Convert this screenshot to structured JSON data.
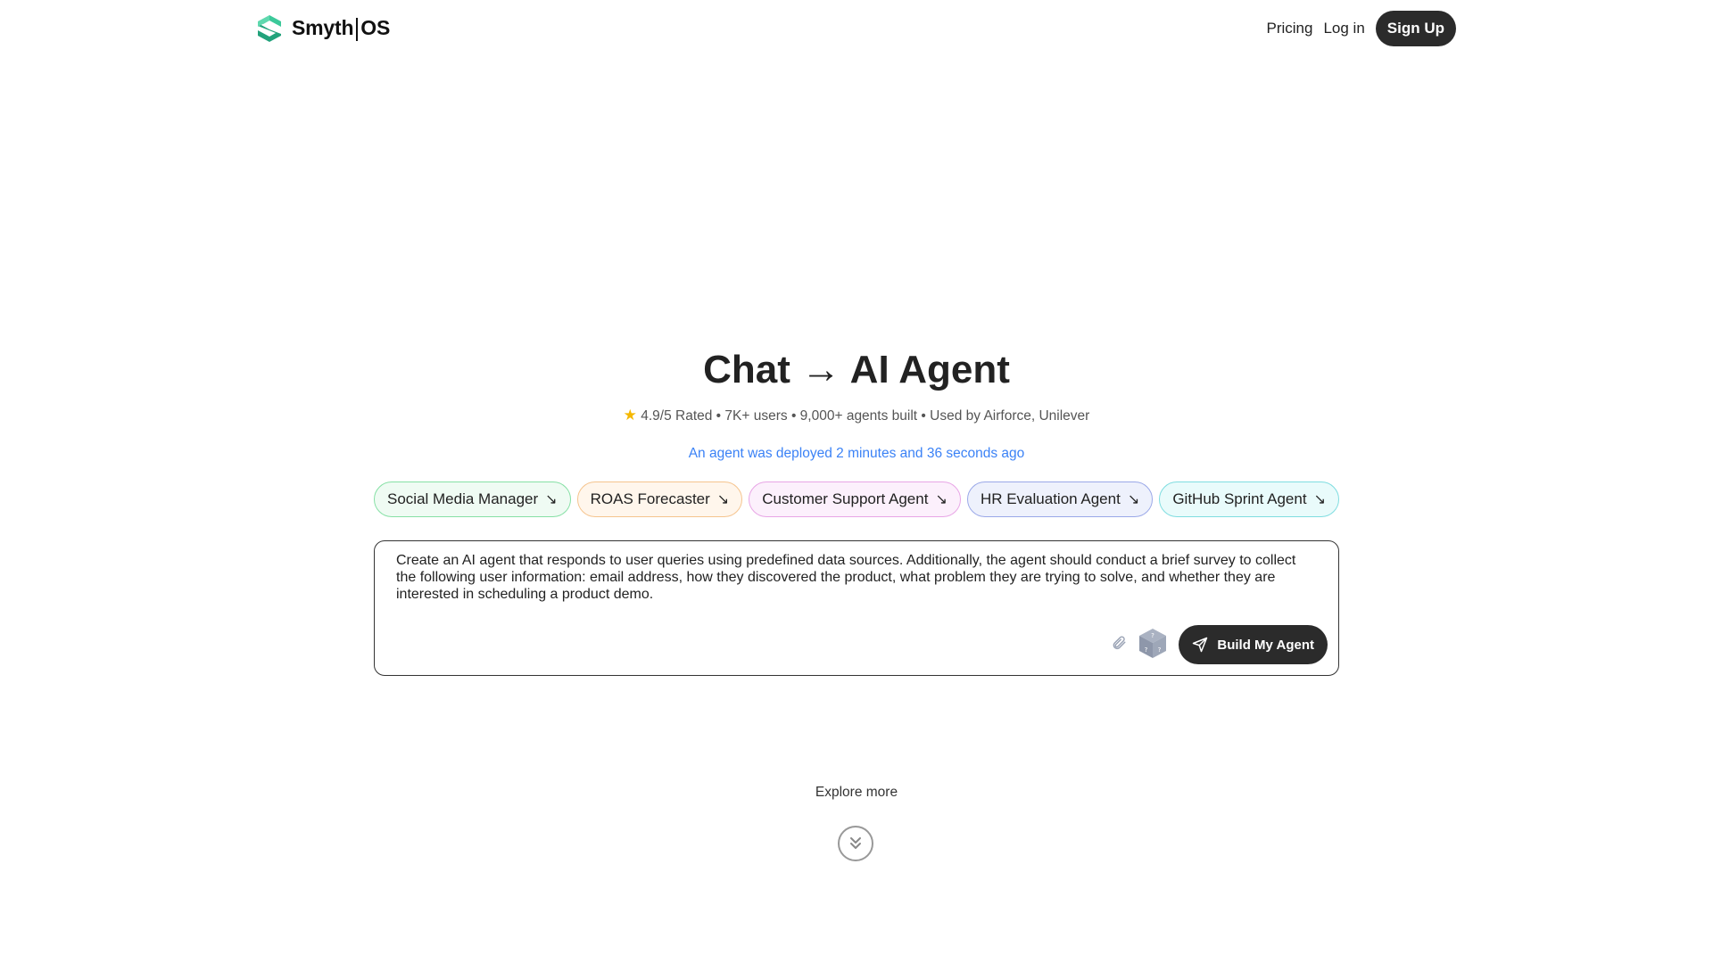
{
  "header": {
    "brand_left": "Smyth",
    "brand_right": "OS",
    "nav": {
      "pricing": "Pricing",
      "login": "Log in",
      "signup": "Sign Up"
    }
  },
  "hero": {
    "title": "Chat → AI Agent",
    "stats": "4.9/5 Rated • 7K+ users • 9,000+ agents built • Used by Airforce, Unilever",
    "deployed": "An agent was deployed 2 minutes and 36 seconds ago"
  },
  "chips": [
    {
      "label": "Social Media Manager",
      "bg": "#effbf3",
      "border": "#86e0a5"
    },
    {
      "label": "ROAS Forecaster",
      "bg": "#fff6ec",
      "border": "#f5c48e"
    },
    {
      "label": "Customer Support Agent",
      "bg": "#fcf0fc",
      "border": "#e8a5e6"
    },
    {
      "label": "HR Evaluation Agent",
      "bg": "#eef1fc",
      "border": "#9aa8e8"
    },
    {
      "label": "GitHub Sprint Agent",
      "bg": "#e9fbfb",
      "border": "#7fdde0"
    }
  ],
  "prompt": {
    "value": "Create an AI agent that responds to user queries using predefined data sources. Additionally, the agent should conduct a brief survey to collect the following user information: email address, how they discovered the product, what problem they are trying to solve, and whether they are interested in scheduling a product demo.",
    "build_label": "Build My Agent"
  },
  "explore": "Explore more",
  "colors": {
    "accent": "#3b82f6",
    "dark_button": "#2b2b2b",
    "logo_green": "#2bb58b"
  }
}
